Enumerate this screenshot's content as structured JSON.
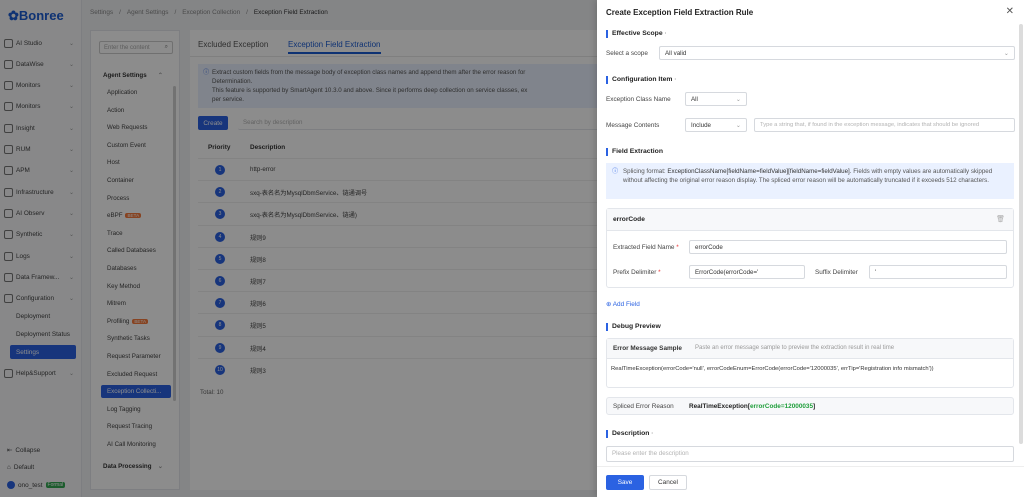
{
  "brand": "Bonree",
  "nav": {
    "items": [
      {
        "label": "AI Studio",
        "icon": "sparkle-icon"
      },
      {
        "label": "DataWise",
        "icon": "data-icon"
      },
      {
        "label": "Monitors",
        "icon": "monitor-icon"
      },
      {
        "label": "Monitors",
        "icon": "monitor-icon"
      },
      {
        "label": "Insight",
        "icon": "insight-icon"
      },
      {
        "label": "RUM",
        "icon": "rum-icon"
      },
      {
        "label": "APM",
        "icon": "apm-icon"
      },
      {
        "label": "Infrastructure",
        "icon": "server-icon"
      },
      {
        "label": "AI Observ",
        "icon": "ai-observ-icon"
      },
      {
        "label": "Synthetic",
        "icon": "synthetic-icon"
      },
      {
        "label": "Logs",
        "icon": "logs-icon"
      },
      {
        "label": "Data Framew...",
        "icon": "framework-icon"
      },
      {
        "label": "Configuration",
        "icon": "config-icon"
      }
    ],
    "sub_items": [
      "Deployment",
      "Deployment Status",
      "Settings"
    ],
    "help": "Help&Support",
    "collapse": "Collapse",
    "default": "Default",
    "user": "ono_test",
    "user_badge": "Formal"
  },
  "breadcrumbs": [
    "Settings",
    "/",
    "Agent Settings",
    "/",
    "Exception Collection",
    "/",
    "Exception Field Extraction"
  ],
  "subnav": {
    "search_placeholder": "Enter the content",
    "group": "Agent Settings",
    "items": [
      "Application",
      "Action",
      "Web Requests",
      "Custom Event",
      "Host",
      "Container",
      "Process",
      "eBPF",
      "Trace",
      "Called Databases",
      "Databases",
      "Key Method",
      "Mitrem",
      "Profiling",
      "Synthetic Tasks",
      "Request Parameter",
      "Excluded Request",
      "Exception Collecti...",
      "Log Tagging",
      "Request Tracing",
      "AI Call Monitoring"
    ],
    "beta": "BETA",
    "data_processing": "Data Processing"
  },
  "main": {
    "tabs": [
      "Excluded Exception",
      "Exception Field Extraction"
    ],
    "info_lines": [
      "Extract custom fields from the message body of exception class names and append them after the error reason for",
      "Determination.",
      "This feature is supported by SmartAgent 10.3.0 and above. Since it performs deep collection on service classes, ex",
      "per service."
    ],
    "create": "Create",
    "search_placeholder": "Search by description",
    "columns": [
      "Priority",
      "Description"
    ],
    "rows": [
      {
        "p": "1",
        "d": "http-error"
      },
      {
        "p": "2",
        "d": "sxq-表名名为MysqlDbmService、链通调号"
      },
      {
        "p": "3",
        "d": "sxq-表名名为MysqlDbmService、链通)"
      },
      {
        "p": "4",
        "d": "规则9"
      },
      {
        "p": "5",
        "d": "规则8"
      },
      {
        "p": "6",
        "d": "规则7"
      },
      {
        "p": "7",
        "d": "规则6"
      },
      {
        "p": "8",
        "d": "规则5"
      },
      {
        "p": "9",
        "d": "规则4"
      },
      {
        "p": "10",
        "d": "规则3"
      }
    ],
    "total": "Total: 10"
  },
  "drawer": {
    "title": "Create Exception Field Extraction Rule",
    "effective_scope": "Effective Scope",
    "select_scope_label": "Select a scope",
    "scope_value": "All valid",
    "config_item": "Configuration Item",
    "class_name_label": "Exception Class Name",
    "class_name_value": "All",
    "message_label": "Message Contents",
    "message_op": "Include",
    "message_placeholder": "Type a string that, if found in the exception message, indicates that should be ignored",
    "field_extraction": "Field Extraction",
    "note_prefix": "Splicing format: ",
    "note_format": "ExceptionClassName[fieldName=fieldValue][fieldName=fieldValue]",
    "note_rest": ". Fields with empty values are automatically skipped without affecting the original error reason display. The spliced error reason will be automatically truncated if it exceeds 512 characters.",
    "card_title": "errorCode",
    "extracted_label": "Extracted Field Name",
    "extracted_value": "errorCode",
    "prefix_label": "Prefix Delimiter",
    "prefix_value": "ErrorCode(errorCode='",
    "suffix_label": "Suffix Delimiter",
    "suffix_value": "'",
    "add_field": "Add Field",
    "debug_preview": "Debug Preview",
    "err_sample_label": "Error Message Sample",
    "err_sample_hint": "Paste an error message sample to preview the extraction result in real time",
    "err_sample_value": "RealTimeException(errorCode='null', errorCodeEnum=ErrorCode(errorCode='12000035', errTip='Registration info mismatch'))",
    "spliced_label": "Spliced Error Reason",
    "spliced_prefix": "RealTimeException[",
    "spliced_key": "errorCode=12000035",
    "spliced_suffix": "]",
    "description": "Description",
    "description_placeholder": "Please enter the description",
    "save": "Save",
    "cancel": "Cancel"
  }
}
